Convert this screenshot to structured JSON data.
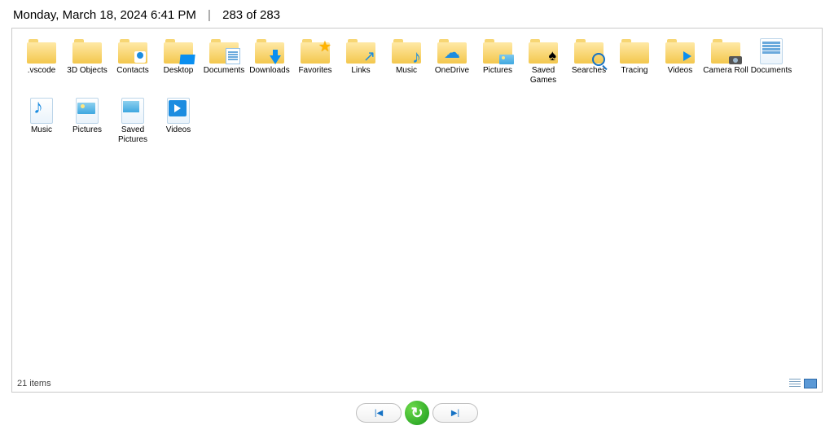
{
  "header": {
    "timestamp": "Monday, March 18, 2024 6:41 PM",
    "counter": "283 of 283"
  },
  "items": [
    {
      "label": ".vscode",
      "type": "folder"
    },
    {
      "label": "3D Objects",
      "type": "folder"
    },
    {
      "label": "Contacts",
      "type": "folder",
      "ov": "contacts"
    },
    {
      "label": "Desktop",
      "type": "folder",
      "ov": "desktop"
    },
    {
      "label": "Documents",
      "type": "folder",
      "ov": "docs"
    },
    {
      "label": "Downloads",
      "type": "folder",
      "ov": "down"
    },
    {
      "label": "Favorites",
      "type": "folder",
      "ov": "star",
      "glyph": "★"
    },
    {
      "label": "Links",
      "type": "folder",
      "ov": "links",
      "glyph": "↗"
    },
    {
      "label": "Music",
      "type": "folder",
      "ov": "note",
      "glyph": "♪"
    },
    {
      "label": "OneDrive",
      "type": "folder",
      "ov": "cloud",
      "glyph": "☁"
    },
    {
      "label": "Pictures",
      "type": "folder",
      "ov": "pic"
    },
    {
      "label": "Saved Games",
      "type": "folder",
      "ov": "spade",
      "glyph": "♠"
    },
    {
      "label": "Searches",
      "type": "folder",
      "ov": "mag"
    },
    {
      "label": "Tracing",
      "type": "folder"
    },
    {
      "label": "Videos",
      "type": "folder",
      "ov": "vid"
    },
    {
      "label": "Camera Roll",
      "type": "folder",
      "ov": "cam"
    },
    {
      "label": "Documents",
      "type": "docfile"
    },
    {
      "label": "Music",
      "type": "lib-music"
    },
    {
      "label": "Pictures",
      "type": "lib-pics"
    },
    {
      "label": "Saved Pictures",
      "type": "lib-saved"
    },
    {
      "label": "Videos",
      "type": "lib-vids"
    }
  ],
  "status": "21 items",
  "controls": {
    "prev": "|◀",
    "reload": "↻",
    "next": "▶|"
  }
}
